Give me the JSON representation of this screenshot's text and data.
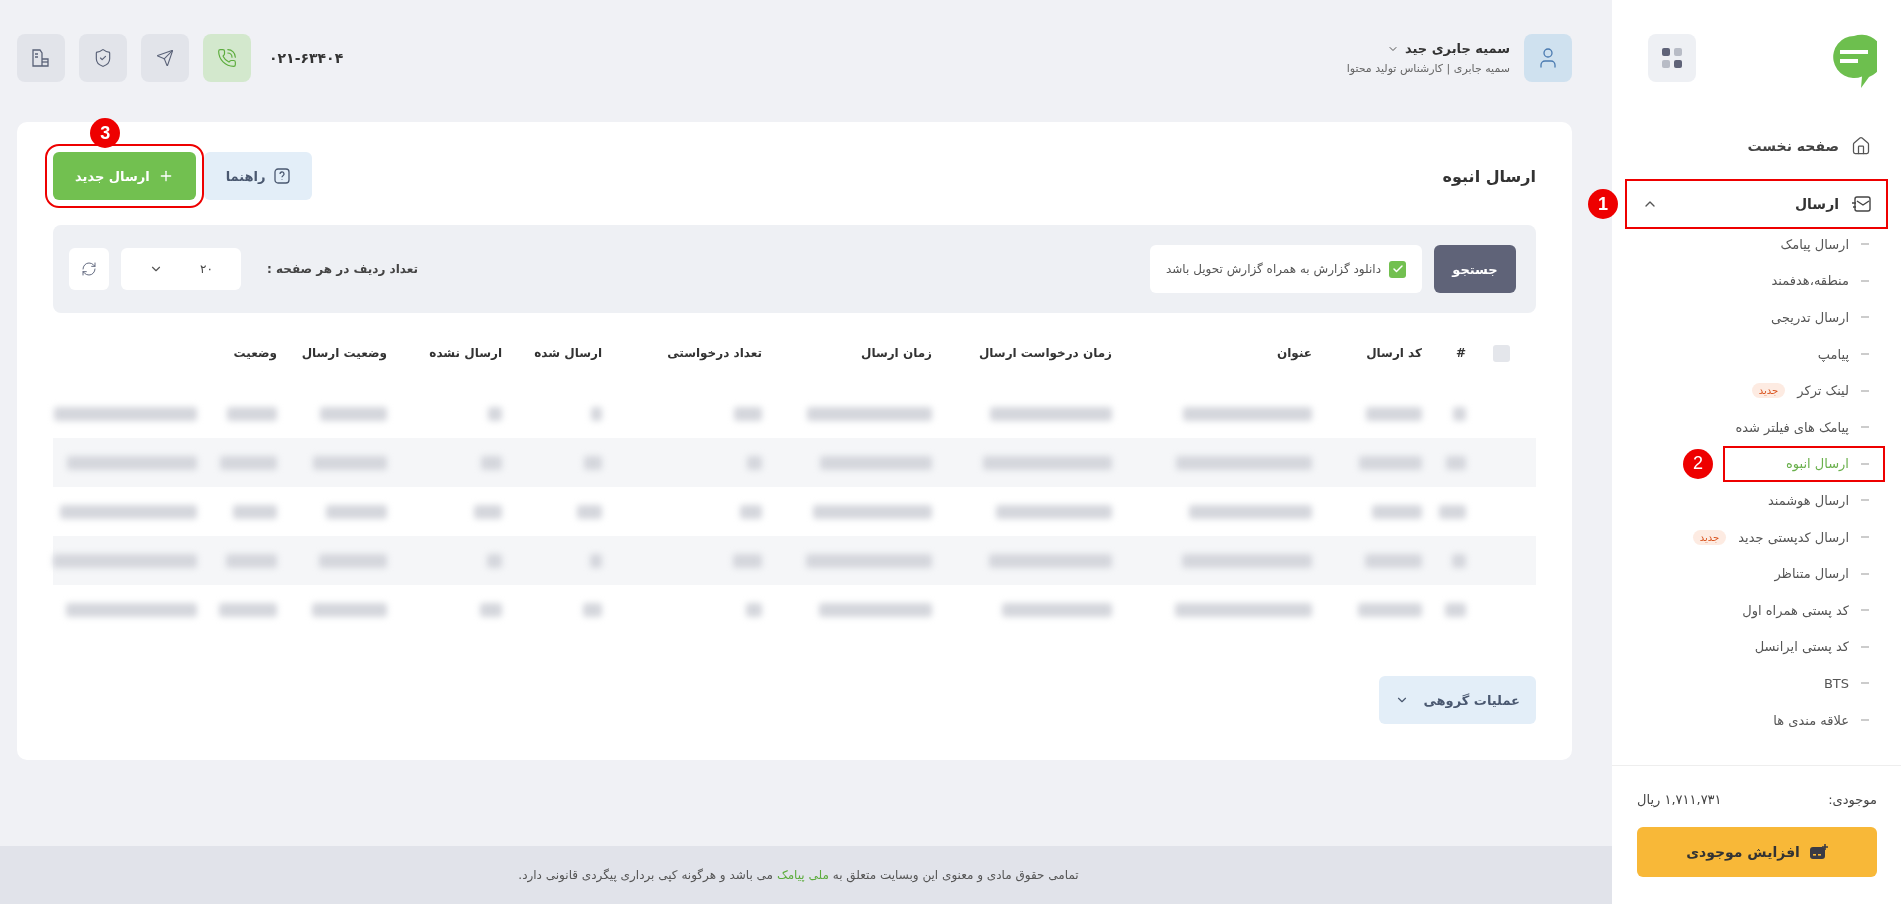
{
  "header": {
    "user": {
      "name": "سمیه جابری جید",
      "subtitle": "سمیه جابری | کارشناس تولید محتوا"
    },
    "phone": "۰۲۱-۶۳۴۰۴"
  },
  "page": {
    "title": "ارسال انبوه",
    "buttons": [
      {
        "label": "راهنما",
        "kind": "help"
      },
      {
        "label": "ارسال جدید",
        "kind": "primary",
        "annotation": "3"
      }
    ]
  },
  "filter": {
    "search_button": "جستجو",
    "checkbox": {
      "label": "دانلود گزارش به همراه گزارش تحویل باشد",
      "checked": true
    },
    "rows_per_page_label": "تعداد ردیف در هر صفحه :",
    "rows_per_page": "۲۰"
  },
  "table": {
    "select_all": {
      "checked": false
    },
    "columns": [
      "#",
      "کد ارسال",
      "عنوان",
      "زمان درخواست ارسال",
      "زمان ارسال",
      "تعداد درخواستی",
      "ارسال شده",
      "ارسال نشده",
      "وضعیت ارسال",
      "وضعیت"
    ],
    "rows": [
      {
        "kind": "blurred"
      },
      {
        "kind": "blurred"
      },
      {
        "kind": "blurred"
      },
      {
        "kind": "blurred"
      },
      {
        "kind": "blurred"
      }
    ]
  },
  "group_actions": "عملیات گروهی",
  "sidebar": {
    "home": "صفحه نخست",
    "group": {
      "label": "ارسال",
      "expanded": true,
      "annotation": "1",
      "items": [
        {
          "label": "ارسال پیامک",
          "selected": false
        },
        {
          "label": "منطقه،هدفمند",
          "selected": false
        },
        {
          "label": "ارسال تدریجی",
          "selected": false
        },
        {
          "label": "پیامپ",
          "selected": false
        },
        {
          "label": "لینک ترکر",
          "selected": false,
          "badge": "جدید"
        },
        {
          "label": "پیامک های فیلتر شده",
          "selected": false
        },
        {
          "label": "ارسال انبوه",
          "selected": true,
          "annotation": "2"
        },
        {
          "label": "ارسال هوشمند",
          "selected": false
        },
        {
          "label": "ارسال کدپستی جدید",
          "selected": false,
          "badge": "جدید"
        },
        {
          "label": "ارسال متناظر",
          "selected": false
        },
        {
          "label": "کد پستی همراه اول",
          "selected": false
        },
        {
          "label": "کد پستی ایرانسل",
          "selected": false
        },
        {
          "label": "BTS",
          "selected": false
        },
        {
          "label": "علاقه مندی ها",
          "selected": false
        }
      ]
    }
  },
  "balance": {
    "label": "موجودی:",
    "amount": "۱,۷۱۱,۷۳۱ ریال",
    "button": "افزایش موجودی"
  },
  "footer": {
    "before": "تمامی حقوق مادی و معنوی این وبسایت متعلق به",
    "link": "ملی پیامک",
    "after": "می باشد و هرگونه کپی برداری پیگردی قانونی دارد."
  }
}
